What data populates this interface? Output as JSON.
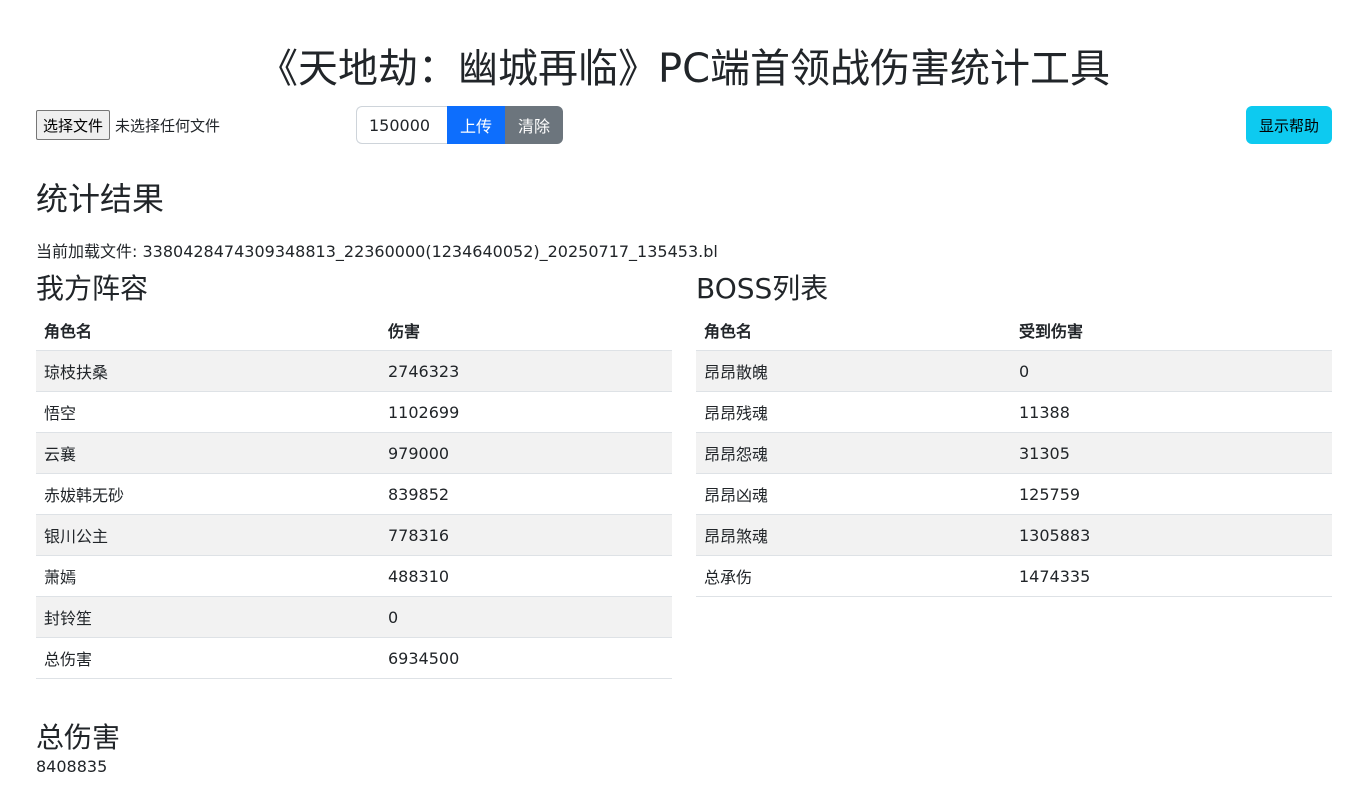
{
  "header": {
    "title": "《天地劫：幽城再临》PC端首领战伤害统计工具"
  },
  "toolbar": {
    "file_button_label": "选择文件",
    "file_status": "未选择任何文件",
    "threshold_value": "150000",
    "upload_label": "上传",
    "clear_label": "清除",
    "help_label": "显示帮助"
  },
  "results": {
    "title": "统计结果",
    "loaded_file": "当前加载文件: 3380428474309348813_22360000(1234640052)_20250717_135453.bl"
  },
  "team": {
    "title": "我方阵容",
    "columns": [
      "角色名",
      "伤害"
    ],
    "rows": [
      {
        "name": "琼枝扶桑",
        "value": "2746323"
      },
      {
        "name": "悟空",
        "value": "1102699"
      },
      {
        "name": "云襄",
        "value": "979000"
      },
      {
        "name": "赤妭韩无砂",
        "value": "839852"
      },
      {
        "name": "银川公主",
        "value": "778316"
      },
      {
        "name": "萧嫣",
        "value": "488310"
      },
      {
        "name": "封铃笙",
        "value": "0"
      },
      {
        "name": "总伤害",
        "value": "6934500"
      }
    ]
  },
  "boss": {
    "title": "BOSS列表",
    "columns": [
      "角色名",
      "受到伤害"
    ],
    "rows": [
      {
        "name": "昂昂散魄",
        "value": "0"
      },
      {
        "name": "昂昂残魂",
        "value": "11388"
      },
      {
        "name": "昂昂怨魂",
        "value": "31305"
      },
      {
        "name": "昂昂凶魂",
        "value": "125759"
      },
      {
        "name": "昂昂煞魂",
        "value": "1305883"
      },
      {
        "name": "总承伤",
        "value": "1474335"
      }
    ]
  },
  "total": {
    "title": "总伤害",
    "value": "8408835"
  }
}
